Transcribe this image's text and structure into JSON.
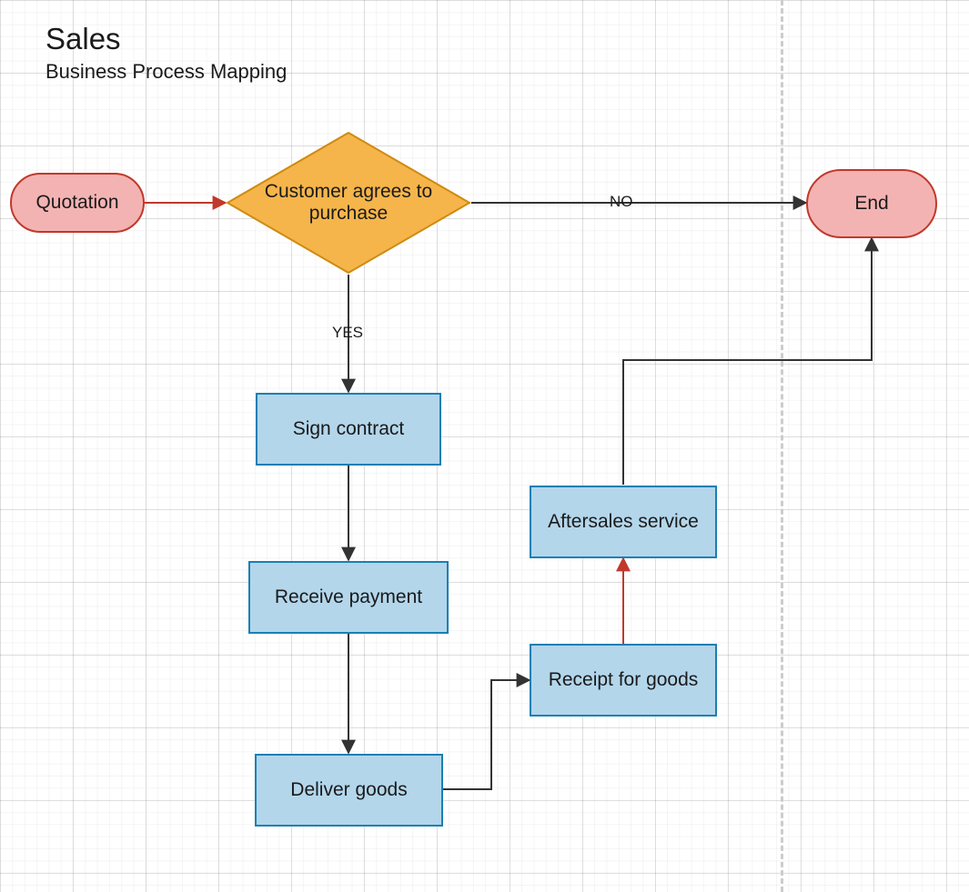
{
  "title": "Sales",
  "subtitle": "Business Process Mapping",
  "nodes": {
    "quotation": "Quotation",
    "decision": "Customer agrees to purchase",
    "end": "End",
    "sign_contract": "Sign contract",
    "receive_payment": "Receive payment",
    "deliver_goods": "Deliver goods",
    "receipt_for_goods": "Receipt for goods",
    "aftersales_service": "Aftersales service"
  },
  "edges": {
    "yes": "YES",
    "no": "NO"
  },
  "colors": {
    "terminator_fill": "#f4b3b3",
    "terminator_stroke": "#c0392b",
    "process_fill": "#b3d6eb",
    "process_stroke": "#1a7fb3",
    "decision_fill": "#f5b54b",
    "decision_stroke": "#cf8b10",
    "connector_black": "#333333",
    "connector_red": "#c0392b"
  }
}
